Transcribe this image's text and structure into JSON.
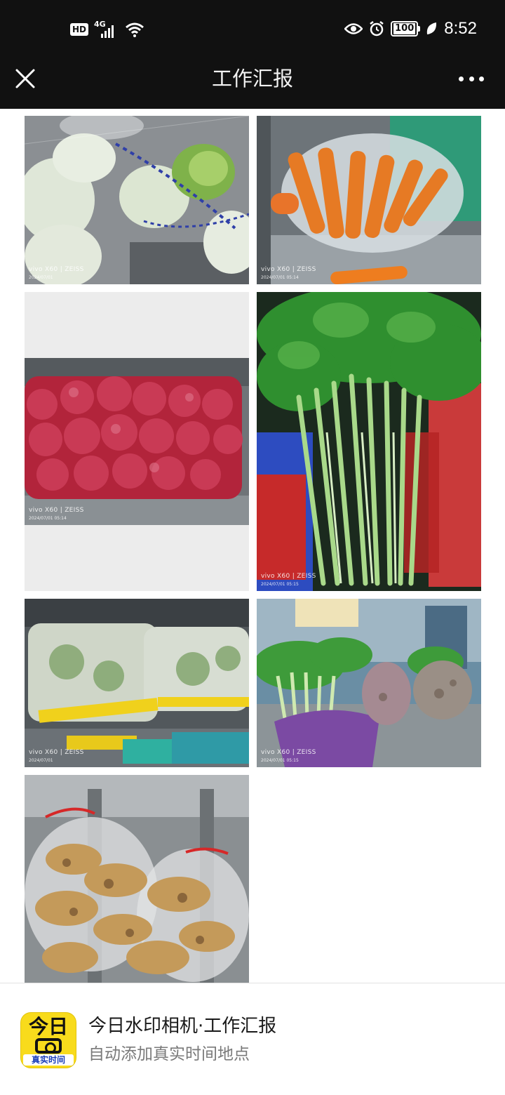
{
  "status_bar": {
    "left_badge": "HD",
    "network": "4G",
    "battery": "100",
    "time": "8:52",
    "icons": [
      "hd-icon",
      "signal-4g-icon",
      "wifi-icon",
      "eye-icon",
      "alarm-icon",
      "battery-icon",
      "leaf-icon"
    ]
  },
  "nav": {
    "title": "工作汇报",
    "close_icon": "close-icon",
    "more_icon": "more-icon"
  },
  "photos": [
    {
      "subject": "cabbage",
      "brand": "vivo X60 | ZEISS",
      "timestamp": "2024/07/01"
    },
    {
      "subject": "carrots",
      "brand": "vivo X60 | ZEISS",
      "timestamp": "2024/07/01 05:14"
    },
    {
      "subject": "red onions",
      "brand": "vivo X60 | ZEISS",
      "timestamp": "2024/07/01 05:14"
    },
    {
      "subject": "celery",
      "brand": "vivo X60 | ZEISS",
      "timestamp": "2024/07/01 05:15"
    },
    {
      "subject": "bagged greens",
      "brand": "vivo X60 | ZEISS",
      "timestamp": "2024/07/01"
    },
    {
      "subject": "leafy vegetables",
      "brand": "vivo X60 | ZEISS",
      "timestamp": "2024/07/01 05:15"
    },
    {
      "subject": "ginger",
      "brand": "",
      "timestamp": ""
    }
  ],
  "footer": {
    "icon_top": "今日",
    "icon_bottom": "真实时间",
    "title": "今日水印相机·工作汇报",
    "subtitle": "自动添加真实时间地点"
  },
  "colors": {
    "topbar": "#111111",
    "app_icon": "#f8db1c",
    "footer_subtitle": "#7a7a7a"
  }
}
